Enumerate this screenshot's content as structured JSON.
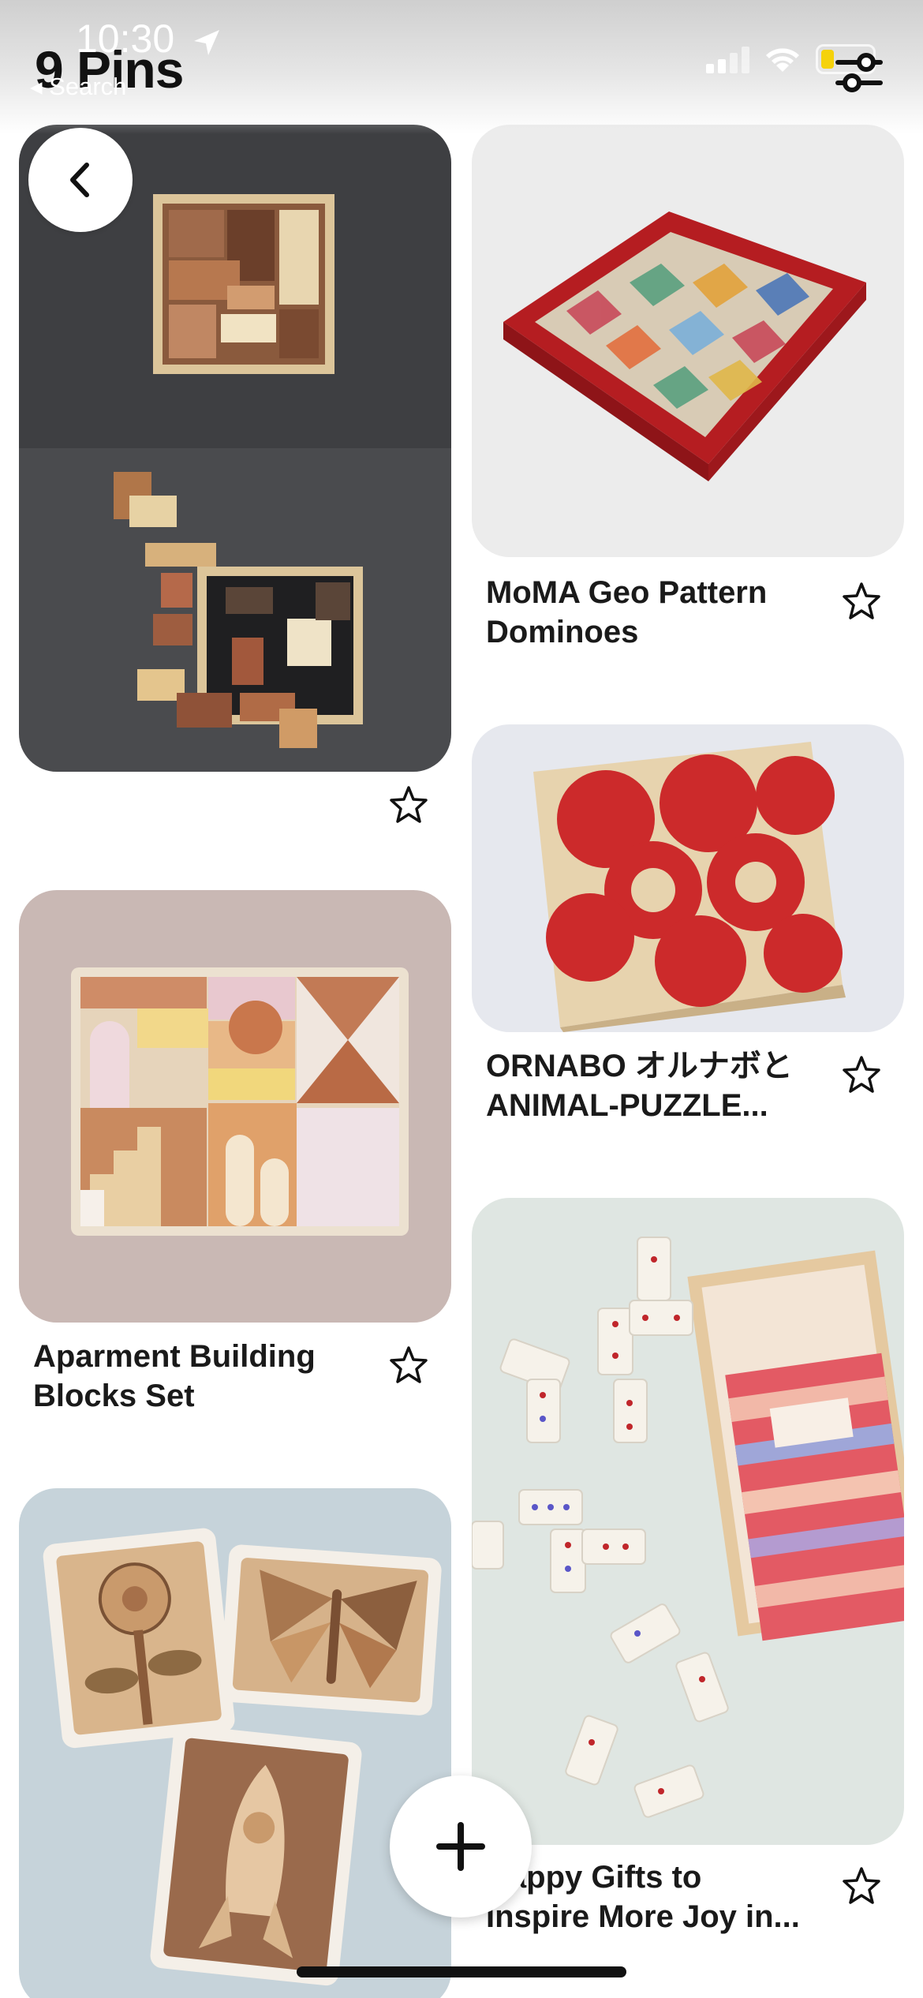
{
  "status_bar": {
    "time": "10:30",
    "back_label": "◂ Search"
  },
  "header": {
    "title": "9 Pins"
  },
  "pins": [
    {
      "title_line1": "",
      "title_line2": "",
      "image": "wooden-block-puzzle"
    },
    {
      "title_line1": "MoMA Geo Pattern",
      "title_line2": "Dominoes",
      "image": "geo-pattern-dominoes"
    },
    {
      "title_line1": "ORNABO オルナボと",
      "title_line2": "ANIMAL-PUZZLE...",
      "image": "red-circle-block-puzzle"
    },
    {
      "title_line1": "Aparment Building",
      "title_line2": "Blocks Set",
      "image": "building-blocks"
    },
    {
      "title_line1": "",
      "title_line2": "",
      "image": "wooden-shape-puzzles"
    },
    {
      "title_line1": "Happy Gifts to",
      "title_line2": "Inspire More Joy in...",
      "image": "dominoes-set"
    }
  ],
  "colors": {
    "accent": "#111111",
    "battery": "#f5d20c",
    "domino_red": "#c0262b"
  }
}
